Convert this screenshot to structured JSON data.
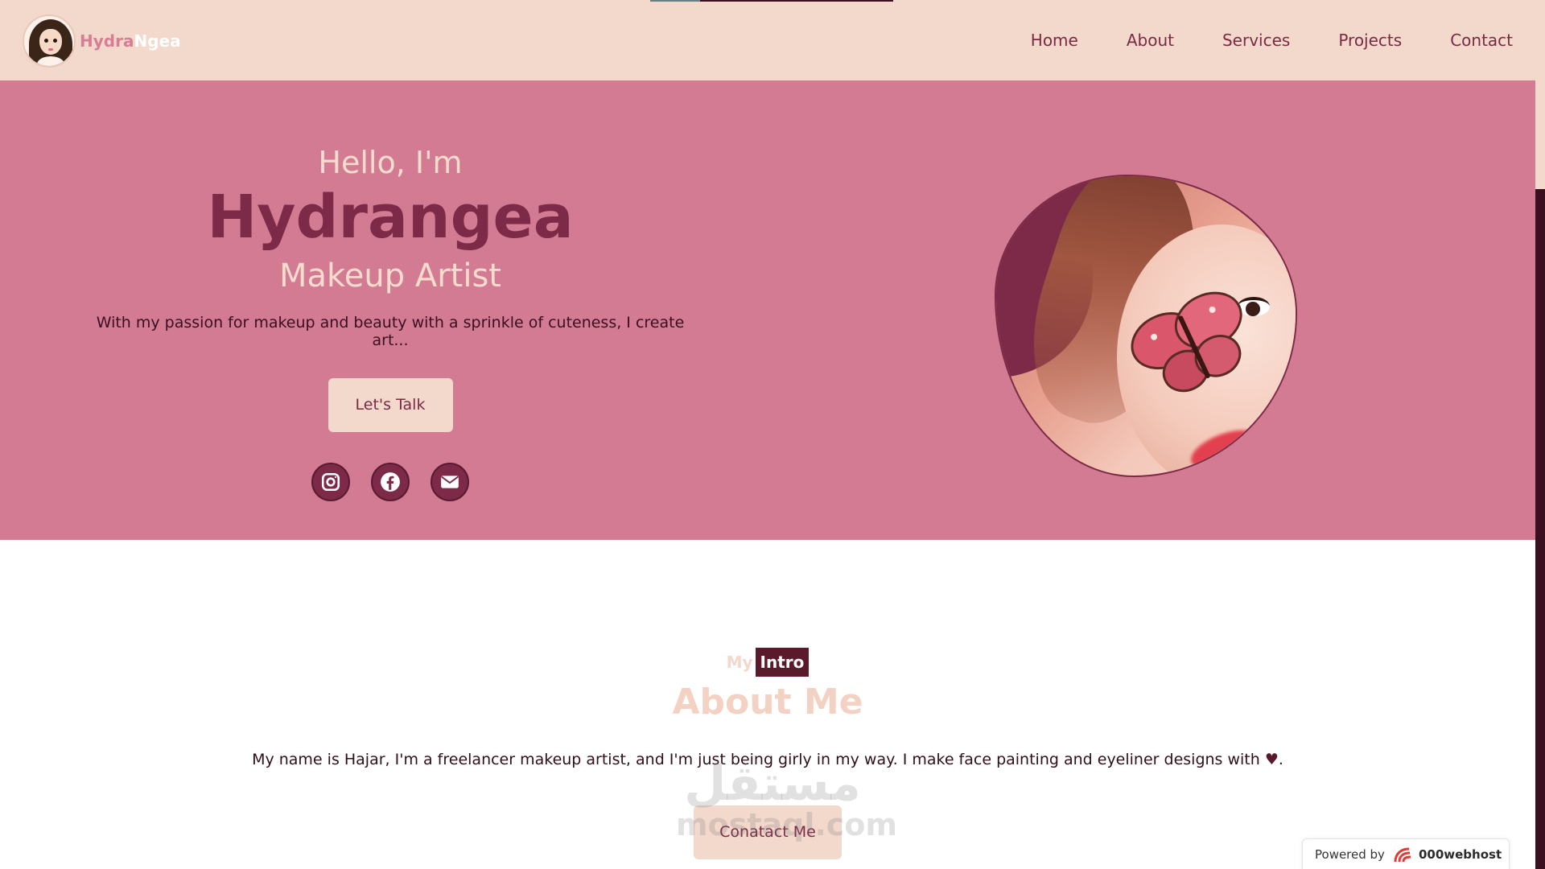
{
  "brand": {
    "part1": "Hydra",
    "part2": "Ngea"
  },
  "nav": [
    {
      "label": "Home"
    },
    {
      "label": "About"
    },
    {
      "label": "Services"
    },
    {
      "label": "Projects"
    },
    {
      "label": "Contact"
    }
  ],
  "hero": {
    "greeting": "Hello, I'm",
    "name": "Hydrangea",
    "role": "Makeup Artist",
    "tagline": "With my passion for makeup and beauty with a sprinkle of cuteness, I create art...",
    "cta": "Let's Talk",
    "socials": [
      "instagram-icon",
      "facebook-icon",
      "envelope-icon"
    ]
  },
  "about": {
    "intro_my": "My",
    "intro_tag": "Intro",
    "title": "About Me",
    "text": "My name is Hajar, I'm a freelancer makeup artist, and I'm just being girly in my way. I make face painting and eyeliner designs with",
    "text_end": ".",
    "heart": "♥",
    "cta": "Conatact Me"
  },
  "watermark": {
    "line1": "مستقل",
    "line2": "mostaql.com"
  },
  "powered": {
    "prefix": "Powered by",
    "name": "000webhost"
  },
  "colors": {
    "nav_bg": "#f3d8cc",
    "hero_bg": "#d27b92",
    "accent": "#7c2a47",
    "dark": "#5a1a2c"
  }
}
